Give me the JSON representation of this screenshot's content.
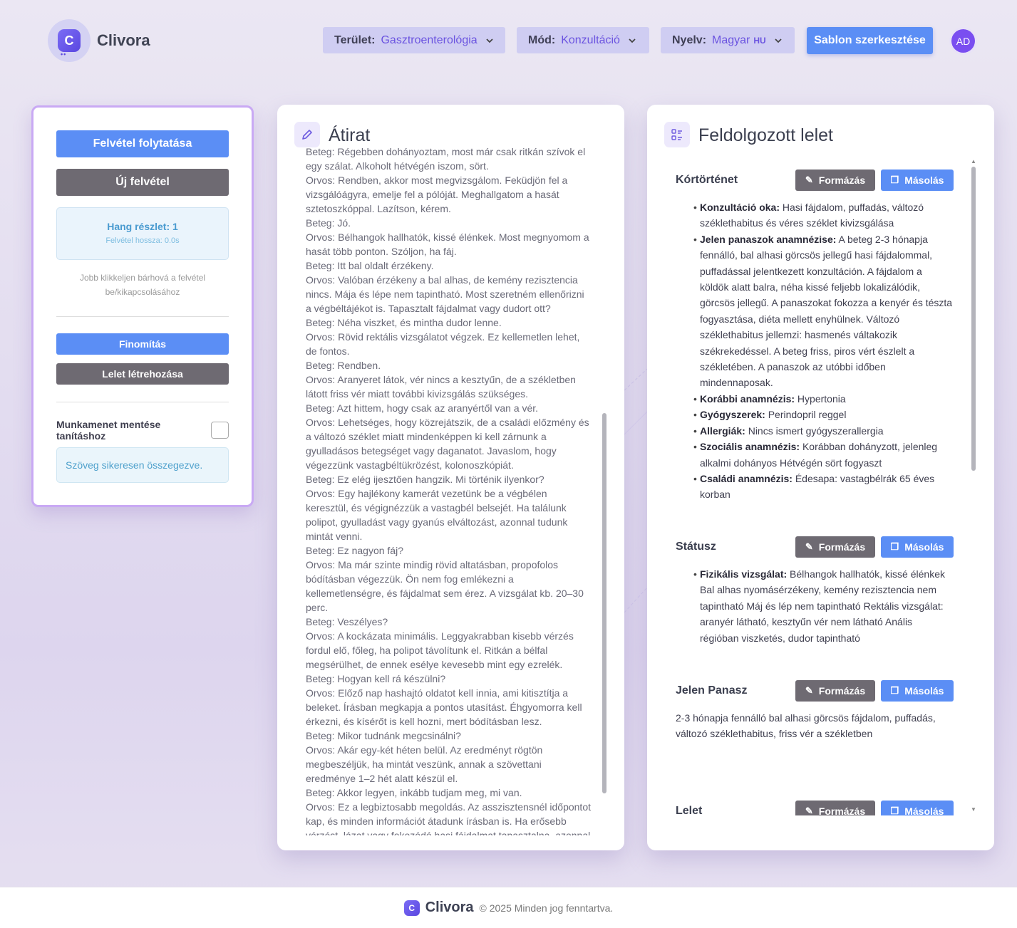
{
  "header": {
    "brand": "Clivora",
    "area_label": "Terület:",
    "area_value": "Gasztroenterológia",
    "mode_label": "Mód:",
    "mode_value": "Konzultáció",
    "lang_label": "Nyelv:",
    "lang_value": "Magyar",
    "lang_code": "HU",
    "template_button": "Sablon szerkesztése",
    "avatar": "AD"
  },
  "left": {
    "continue_button": "Felvétel folytatása",
    "new_button": "Új felvétel",
    "segment_label": "Hang részlet: 1",
    "duration_label": "Felvétel hossza: 0.0s",
    "hint": "Jobb klikkeljen bárhová a felvétel be/kikapcsolásához",
    "refine_button": "Finomítás",
    "create_button": "Lelet létrehozása",
    "save_label": "Munkamenet mentése tanításhoz",
    "status_message": "Szöveg sikeresen összegezve."
  },
  "transcript": {
    "title": "Átirat",
    "lines": [
      "Beteg: Régebben dohányoztam, most már csak ritkán szívok el egy szálat. Alkoholt hétvégén iszom, sört.",
      "Orvos: Rendben, akkor most megvizsgálom. Feküdjön fel a vizsgálóágyra, emelje fel a pólóját. Meghallgatom a hasát sztetoszkóppal. Lazítson, kérem.",
      "Beteg: Jó.",
      "Orvos: Bélhangok hallhatók, kissé élénkek. Most megnyomom a hasát több ponton. Szóljon, ha fáj.",
      "Beteg: Itt bal oldalt érzékeny.",
      "Orvos: Valóban érzékeny a bal alhas, de kemény rezisztencia nincs. Mája és lépe nem tapintható. Most szeretném ellenőrizni a végbéltájékot is. Tapasztalt fájdalmat vagy dudort ott?",
      "Beteg: Néha viszket, és mintha dudor lenne.",
      "Orvos: Rövid rektális vizsgálatot végzek. Ez kellemetlen lehet, de fontos.",
      "Beteg: Rendben.",
      "Orvos: Aranyeret látok, vér nincs a kesztyűn, de a székletben látott friss vér miatt további kivizsgálás szükséges.",
      "Beteg: Azt hittem, hogy csak az aranyértől van a vér.",
      "Orvos: Lehetséges, hogy közrejátszik, de a családi előzmény és a változó széklet miatt mindenképpen ki kell zárnunk a gyulladásos betegséget vagy daganatot. Javaslom, hogy végezzünk vastagbéltükrözést, kolonoszkópiát.",
      "Beteg: Ez elég ijesztően hangzik. Mi történik ilyenkor?",
      "Orvos: Egy hajlékony kamerát vezetünk be a végbélen keresztül, és végignézzük a vastagbél belsejét. Ha találunk polipot, gyulladást vagy gyanús elváltozást, azonnal tudunk mintát venni.",
      "Beteg: Ez nagyon fáj?",
      "Orvos: Ma már szinte mindig rövid altatásban, propofolos bódításban végezzük. Ön nem fog emlékezni a kellemetlenségre, és fájdalmat sem érez. A vizsgálat kb. 20–30 perc.",
      "Beteg: Veszélyes?",
      "Orvos: A kockázata minimális. Leggyakrabban kisebb vérzés fordul elő, főleg, ha polipot távolítunk el. Ritkán a bélfal megsérülhet, de ennek esélye kevesebb mint egy ezrelék.",
      "Beteg: Hogyan kell rá készülni?",
      "Orvos: Előző nap hashajtó oldatot kell innia, ami kitisztítja a beleket. Írásban megkapja a pontos utasítást. Éhgyomorra kell érkezni, és kísérőt is kell hozni, mert bódításban lesz.",
      "Beteg: Mikor tudnánk megcsinálni?",
      "Orvos: Akár egy-két héten belül. Az eredményt rögtön megbeszéljük, ha mintát veszünk, annak a szövettani eredménye 1–2 hét alatt készül el.",
      "Beteg: Akkor legyen, inkább tudjam meg, mi van.",
      "Orvos: Ez a legbiztosabb megoldás. Az asszisztensnél időpontot kap, és minden információt átadunk írásban is. Ha erősebb vérzést, lázat vagy fokozódó hasi fájdalmat tapasztalna, azonnal keressen fel bennünket vagy az ügyeletet."
    ]
  },
  "report": {
    "title": "Feldolgozott lelet",
    "format_label": "Formázás",
    "copy_label": "Másolás",
    "sections": [
      {
        "title": "Kórtörténet",
        "items": [
          {
            "k": "Konzultáció oka:",
            "v": " Hasi fájdalom, puffadás, változó széklethabitus és véres széklet kivizsgálása"
          },
          {
            "k": "Jelen panaszok anamnézise:",
            "v": " A beteg 2-3 hónapja fennálló, bal alhasi görcsös jellegű hasi fájdalommal, puffadással jelentkezett konzultáción. A fájdalom a köldök alatt balra, néha kissé feljebb lokalizálódik, görcsös jellegű. A panaszokat fokozza a kenyér és tészta fogyasztása, diéta mellett enyhülnek. Változó széklethabitus jellemzi: hasmenés váltakozik székrekedéssel. A beteg friss, piros vért észlelt a székletében. A panaszok az utóbbi időben mindennaposak."
          },
          {
            "k": "Korábbi anamnézis:",
            "v": " Hypertonia"
          },
          {
            "k": "Gyógyszerek:",
            "v": " Perindopril reggel"
          },
          {
            "k": "Allergiák:",
            "v": " Nincs ismert gyógyszerallergia"
          },
          {
            "k": "Szociális anamnézis:",
            "v": " Korábban dohányzott, jelenleg alkalmi dohányos Hétvégén sört fogyaszt"
          },
          {
            "k": "Családi anamnézis:",
            "v": " Édesapa: vastagbélrák 65 éves korban"
          }
        ]
      },
      {
        "title": "Státusz",
        "items": [
          {
            "k": "Fizikális vizsgálat:",
            "v": " Bélhangok hallhatók, kissé élénkek Bal alhas nyomásérzékeny, kemény rezisztencia nem tapintható Máj és lép nem tapintható Rektális vizsgálat: aranyér látható, kesztyűn vér nem látható Anális régióban viszketés, dudor tapintható"
          }
        ]
      },
      {
        "title": "Jelen Panasz",
        "text": "2-3 hónapja fennálló bal alhasi görcsös fájdalom, puffadás, változó széklethabitus, friss vér a székletben"
      },
      {
        "title": "Lelet"
      }
    ]
  },
  "footer": {
    "brand": "Clivora",
    "copyright": "© 2025 Minden jog fenntartva."
  }
}
